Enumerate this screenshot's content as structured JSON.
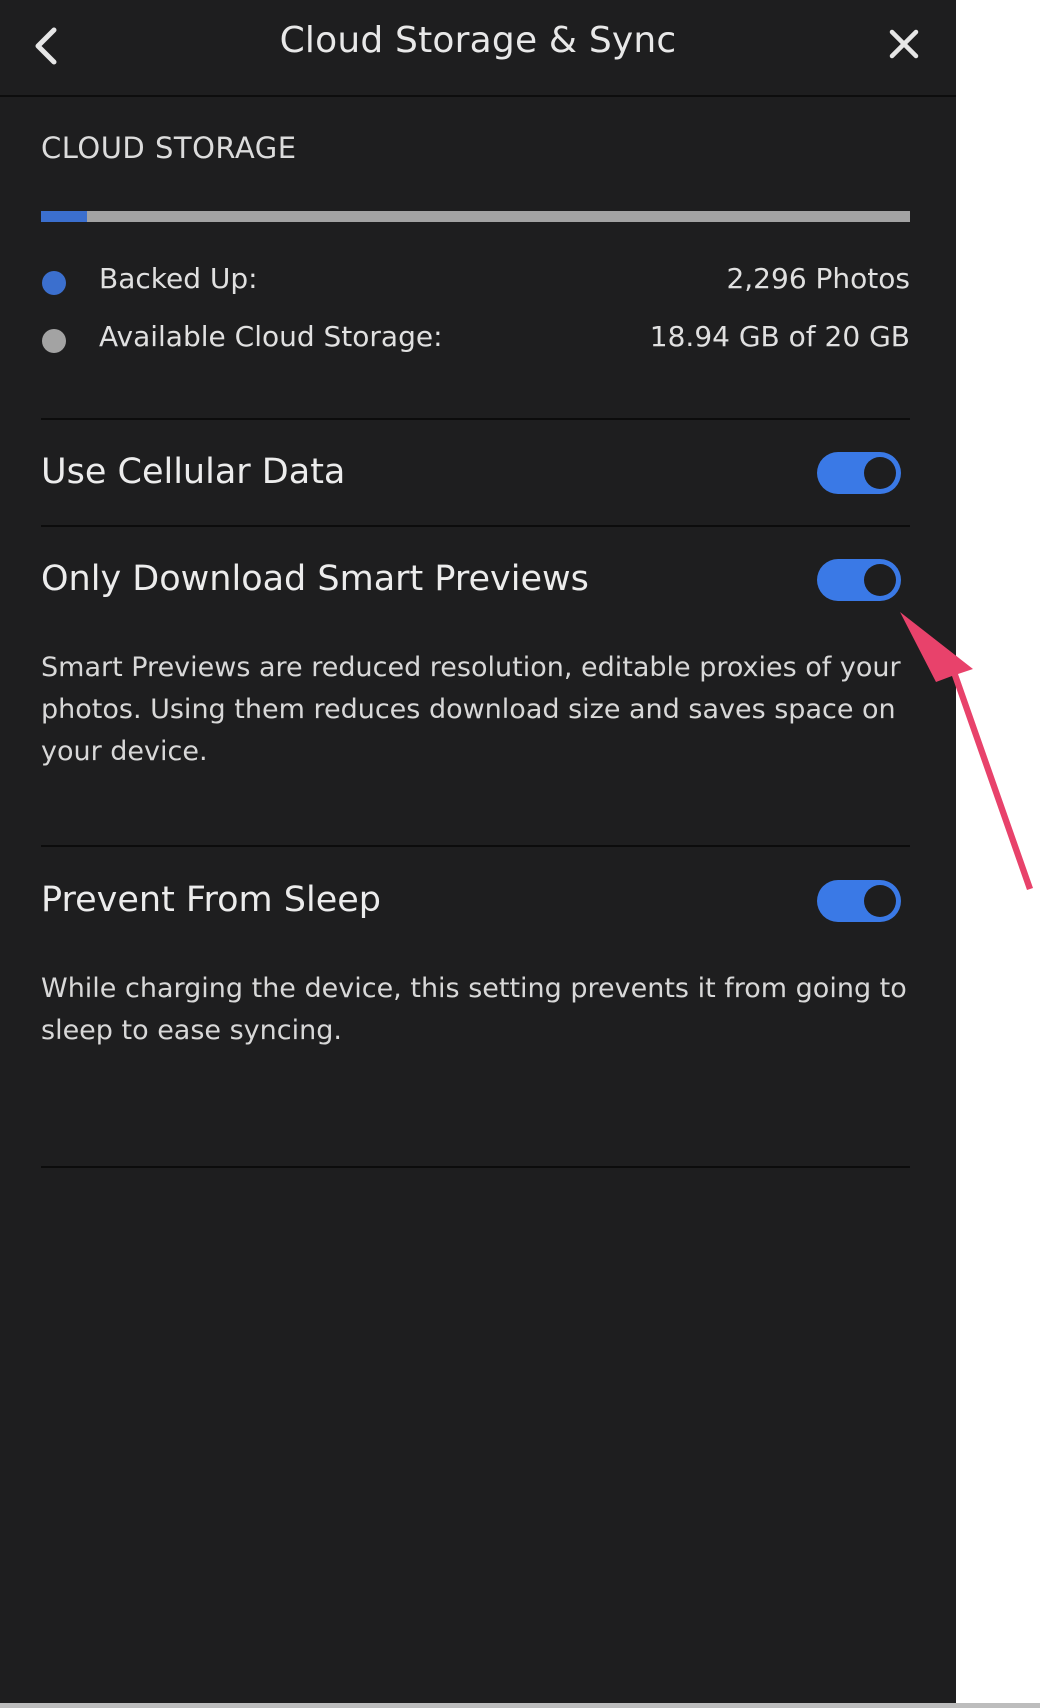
{
  "header": {
    "title": "Cloud Storage & Sync",
    "back_icon": "chevron-left-icon",
    "close_icon": "close-icon"
  },
  "cloud_storage": {
    "section_label": "CLOUD STORAGE",
    "used_fraction": 0.053,
    "bar_fill_color": "#3b6fce",
    "bar_track_color": "#a3a3a3",
    "legend": [
      {
        "label": "Backed Up:",
        "value": "2,296 Photos",
        "dot_color": "#3b6fce"
      },
      {
        "label": "Available Cloud Storage:",
        "value": "18.94 GB of 20 GB",
        "dot_color": "#a3a3a3"
      }
    ]
  },
  "settings": [
    {
      "label": "Use Cellular Data",
      "enabled": true
    },
    {
      "label": "Only Download Smart Previews",
      "enabled": true,
      "description": "Smart Previews are reduced resolution, editable proxies of your photos. Using them reduces download size and saves space on your device."
    },
    {
      "label": "Prevent From Sleep",
      "enabled": true,
      "description": "While charging the device, this setting prevents it from going to sleep to ease syncing."
    }
  ],
  "colors": {
    "panel_bg": "#1e1e1f",
    "toggle_on": "#3a79e6",
    "annotation_arrow": "#e8426b"
  }
}
